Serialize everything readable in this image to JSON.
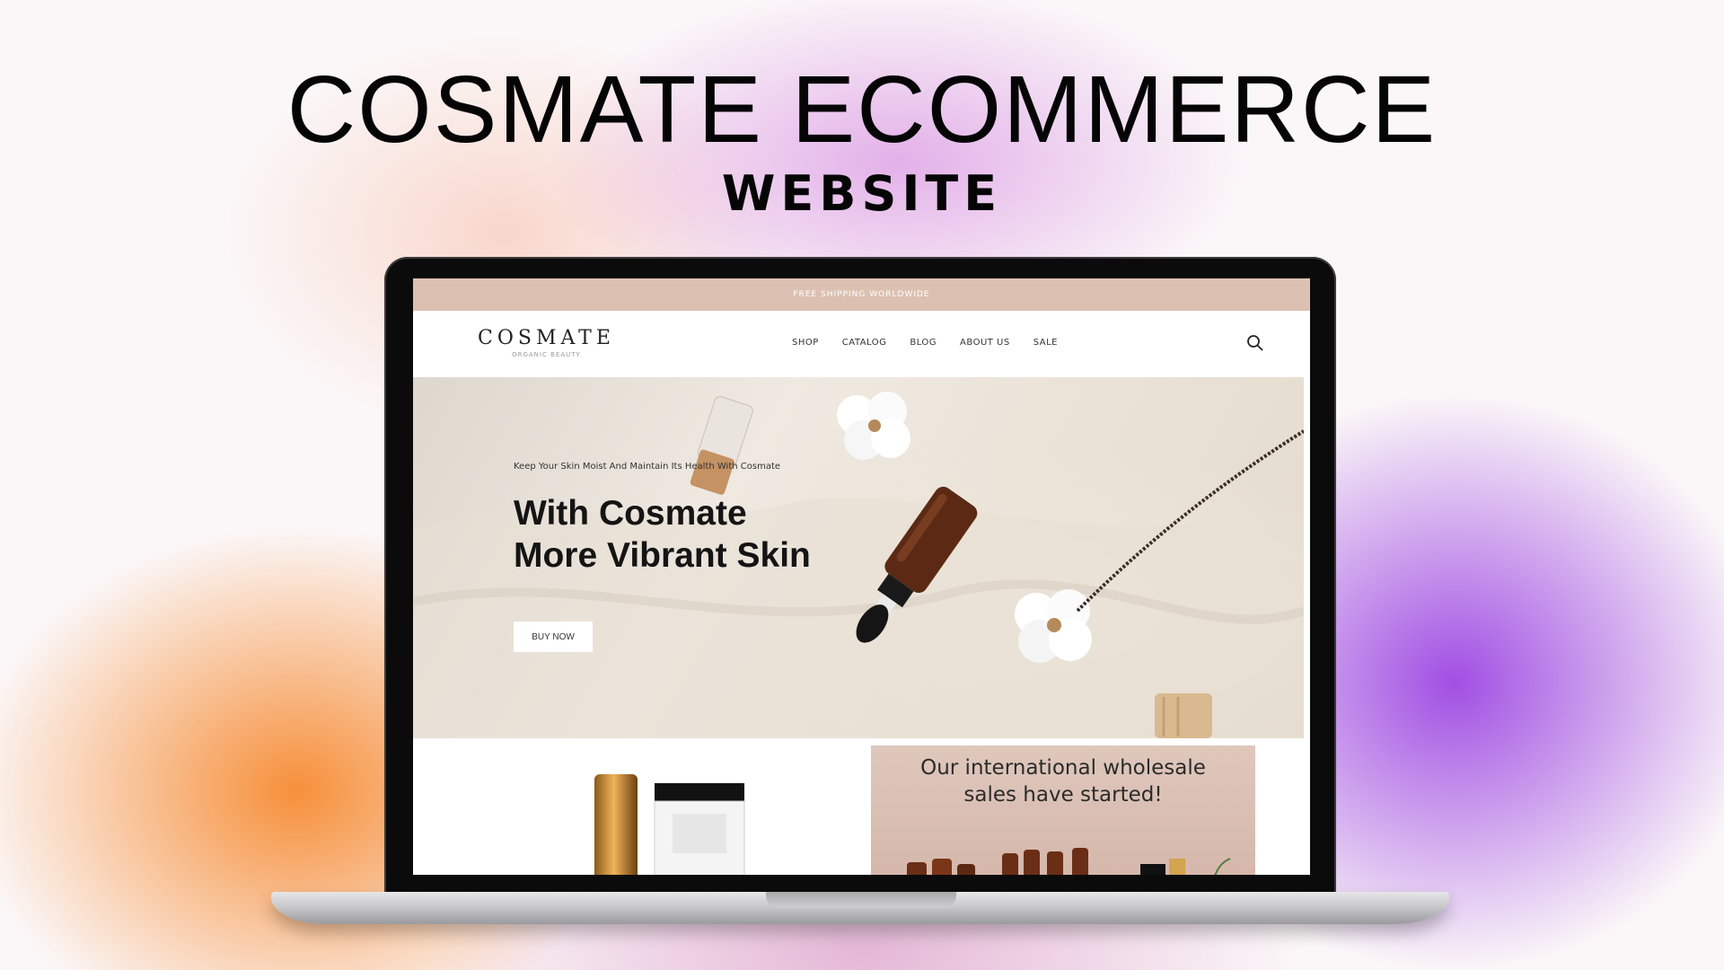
{
  "headline": "COSMATE ECOMMERCE",
  "subhead": "WEBSITE",
  "colors": {
    "announce_bar": "#dcc0b1",
    "accent_orange": "#f68a30",
    "accent_purple": "#9c46e2",
    "dark": "#141414"
  },
  "site": {
    "announcement": "FREE SHIPPING WORLDWIDE",
    "logo": "COSMATE",
    "logo_tagline": "ORGANIC BEAUTY",
    "nav": [
      "SHOP",
      "CATALOG",
      "BLOG",
      "ABOUT US",
      "SALE"
    ],
    "search_icon": "search-icon",
    "hero": {
      "kicker": "Keep Your Skin Moist And Maintain Its Health With Cosmate",
      "title_line1": "With Cosmate",
      "title_line2": "More Vibrant Skin",
      "button": "BUY NOW"
    },
    "promo": {
      "wholesale_line1": "Our international wholesale",
      "wholesale_line2": "sales have started!"
    }
  }
}
